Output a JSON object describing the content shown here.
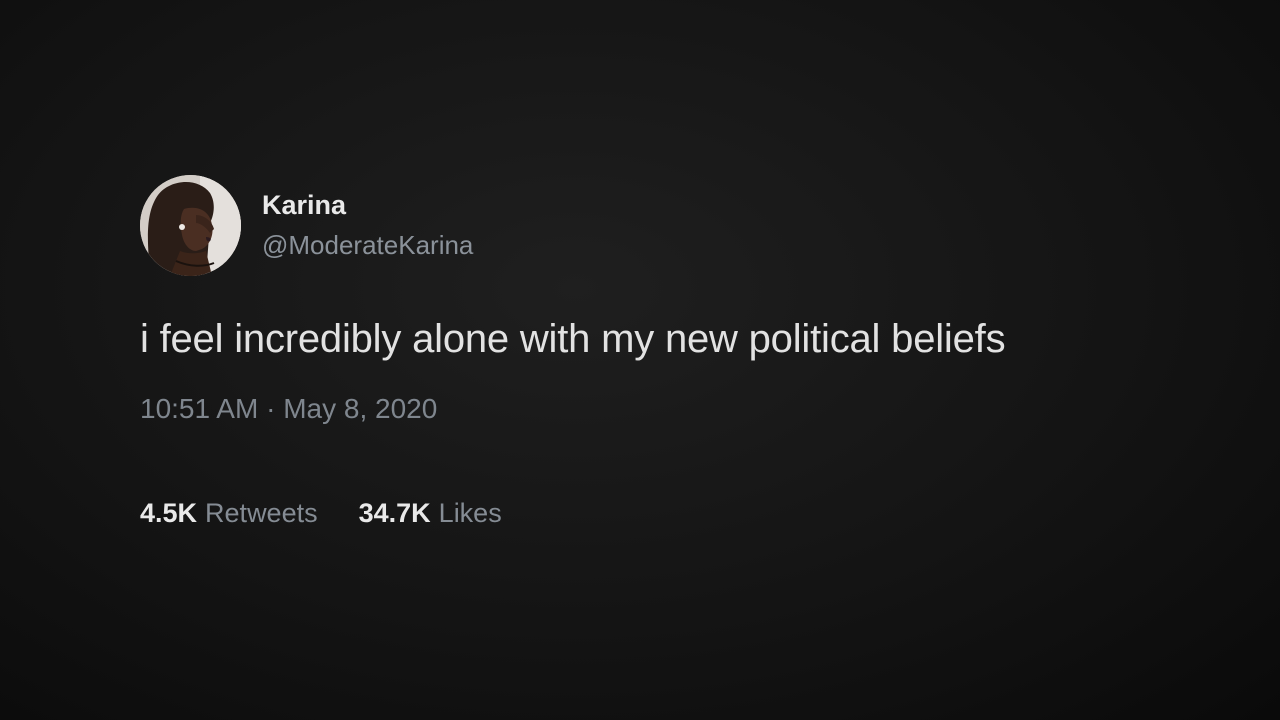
{
  "author": {
    "display_name": "Karina",
    "handle": "@ModerateKarina"
  },
  "tweet": {
    "text": "i feel incredibly alone with my new political beliefs",
    "time": "10:51 AM",
    "separator": "·",
    "date": "May 8, 2020"
  },
  "stats": {
    "retweets_count": "4.5K",
    "retweets_label": "Retweets",
    "likes_count": "34.7K",
    "likes_label": "Likes"
  },
  "colors": {
    "background": "#141414",
    "primary_text": "#e2e2e2",
    "secondary_text": "#8b929a"
  }
}
